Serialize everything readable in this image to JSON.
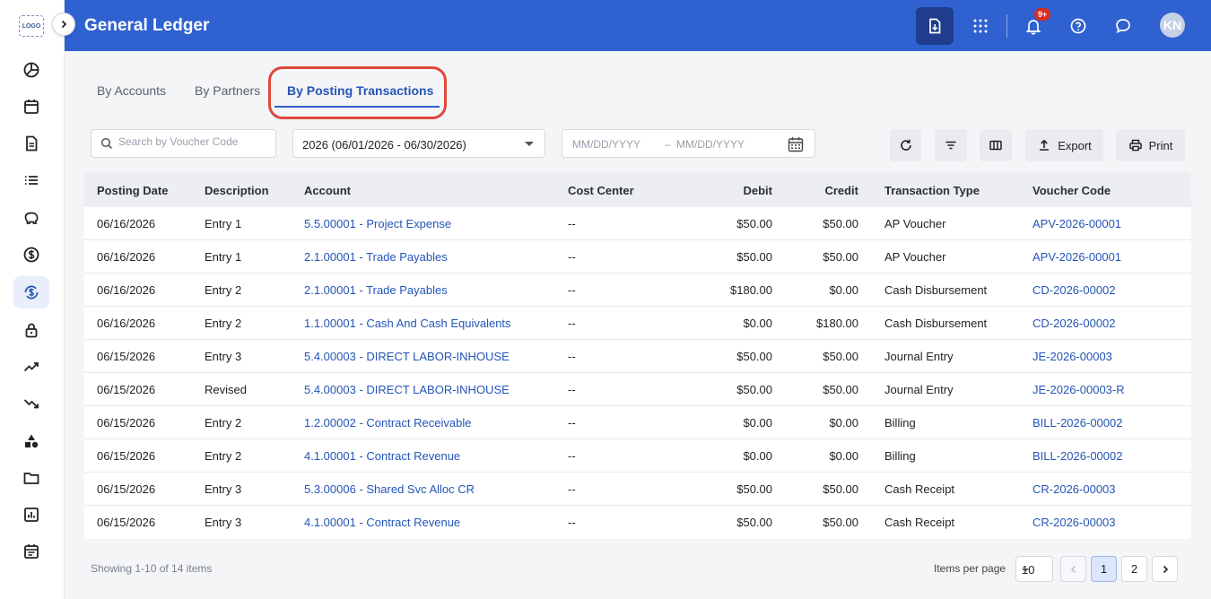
{
  "app": {
    "logo_text": "LOGO",
    "title": "General Ledger",
    "notification_count": "9+",
    "user_initials": "KN"
  },
  "tabs": [
    {
      "label": "By Accounts"
    },
    {
      "label": "By Partners"
    },
    {
      "label": "By Posting Transactions"
    }
  ],
  "filters": {
    "search_placeholder": "Search by Voucher Code",
    "period_value": "2026 (06/01/2026 - 06/30/2026)",
    "date_from_placeholder": "MM/DD/YYYY",
    "date_separator": "–",
    "date_to_placeholder": "MM/DD/YYYY"
  },
  "toolbar": {
    "export_label": "Export",
    "print_label": "Print"
  },
  "table": {
    "columns": [
      "Posting Date",
      "Description",
      "Account",
      "Cost Center",
      "Debit",
      "Credit",
      "Transaction Type",
      "Voucher Code"
    ],
    "rows": [
      {
        "date": "06/16/2026",
        "desc": "Entry 1",
        "account": "5.5.00001 - Project Expense",
        "cost_center": "--",
        "debit": "$50.00",
        "credit": "$50.00",
        "type": "AP Voucher",
        "voucher": "APV-2026-00001"
      },
      {
        "date": "06/16/2026",
        "desc": "Entry 1",
        "account": "2.1.00001 - Trade Payables",
        "cost_center": "--",
        "debit": "$50.00",
        "credit": "$50.00",
        "type": "AP Voucher",
        "voucher": "APV-2026-00001"
      },
      {
        "date": "06/16/2026",
        "desc": "Entry 2",
        "account": "2.1.00001 - Trade Payables",
        "cost_center": "--",
        "debit": "$180.00",
        "credit": "$0.00",
        "type": "Cash Disbursement",
        "voucher": "CD-2026-00002"
      },
      {
        "date": "06/16/2026",
        "desc": "Entry 2",
        "account": "1.1.00001 - Cash And Cash Equivalents",
        "cost_center": "--",
        "debit": "$0.00",
        "credit": "$180.00",
        "type": "Cash Disbursement",
        "voucher": "CD-2026-00002"
      },
      {
        "date": "06/15/2026",
        "desc": "Entry 3",
        "account": "5.4.00003 - DIRECT LABOR-INHOUSE",
        "cost_center": "--",
        "debit": "$50.00",
        "credit": "$50.00",
        "type": "Journal Entry",
        "voucher": "JE-2026-00003"
      },
      {
        "date": "06/15/2026",
        "desc": "Revised",
        "account": "5.4.00003 - DIRECT LABOR-INHOUSE",
        "cost_center": "--",
        "debit": "$50.00",
        "credit": "$50.00",
        "type": "Journal Entry",
        "voucher": "JE-2026-00003-R"
      },
      {
        "date": "06/15/2026",
        "desc": "Entry 2",
        "account": "1.2.00002 - Contract Receivable",
        "cost_center": "--",
        "debit": "$0.00",
        "credit": "$0.00",
        "type": "Billing",
        "voucher": "BILL-2026-00002"
      },
      {
        "date": "06/15/2026",
        "desc": "Entry 2",
        "account": "4.1.00001 - Contract Revenue",
        "cost_center": "--",
        "debit": "$0.00",
        "credit": "$0.00",
        "type": "Billing",
        "voucher": "BILL-2026-00002"
      },
      {
        "date": "06/15/2026",
        "desc": "Entry 3",
        "account": "5.3.00006 - Shared Svc Alloc CR",
        "cost_center": "--",
        "debit": "$50.00",
        "credit": "$50.00",
        "type": "Cash Receipt",
        "voucher": "CR-2026-00003"
      },
      {
        "date": "06/15/2026",
        "desc": "Entry 3",
        "account": "4.1.00001 - Contract Revenue",
        "cost_center": "--",
        "debit": "$50.00",
        "credit": "$50.00",
        "type": "Cash Receipt",
        "voucher": "CR-2026-00003"
      }
    ]
  },
  "footer": {
    "showing_text": "Showing 1-10 of 14 items",
    "items_per_page_label": "Items per page",
    "items_per_page_value": "10",
    "pages": [
      "1",
      "2"
    ]
  },
  "colors": {
    "header": "#2f61d0",
    "link": "#2455b8",
    "highlight": "#e0463a"
  }
}
